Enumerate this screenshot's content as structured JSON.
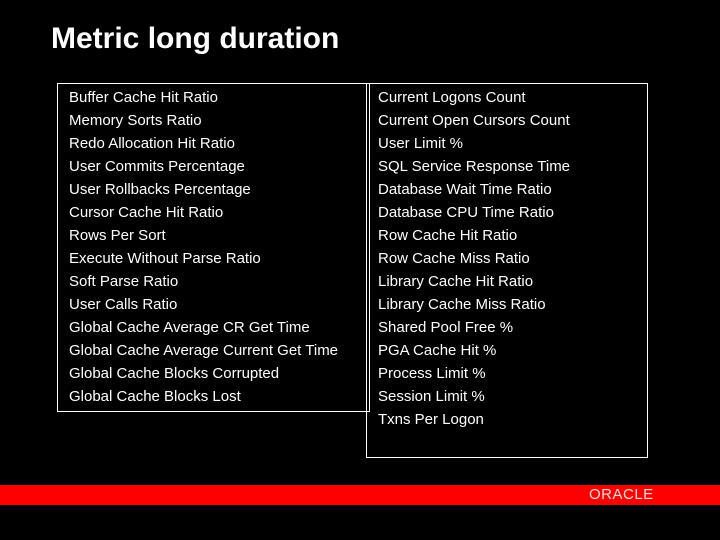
{
  "slide": {
    "title": "Metric long duration",
    "left_column": {
      "items": [
        "Buffer Cache Hit Ratio",
        "Memory Sorts Ratio",
        "Redo Allocation Hit Ratio",
        "User Commits Percentage",
        "User Rollbacks Percentage",
        "Cursor Cache Hit Ratio",
        "Rows Per Sort",
        "Execute Without Parse Ratio",
        "Soft Parse Ratio",
        "User Calls Ratio",
        "Global Cache Average CR Get Time",
        "Global Cache Average Current Get Time",
        "Global Cache Blocks Corrupted",
        "Global Cache Blocks Lost"
      ]
    },
    "right_column": {
      "items": [
        "Current Logons Count",
        "Current Open Cursors Count",
        "User Limit %",
        "SQL Service Response Time",
        "Database Wait Time Ratio",
        "Database CPU Time Ratio",
        "Row Cache Hit Ratio",
        "Row Cache Miss Ratio",
        "Library Cache Hit Ratio",
        "Library Cache Miss Ratio",
        "Shared Pool Free %",
        "PGA Cache Hit %",
        "Process Limit %",
        "Session Limit %",
        "Txns Per Logon"
      ]
    },
    "footer": {
      "logo_text": "ORACLE",
      "bar_color": "#ff0000"
    }
  }
}
